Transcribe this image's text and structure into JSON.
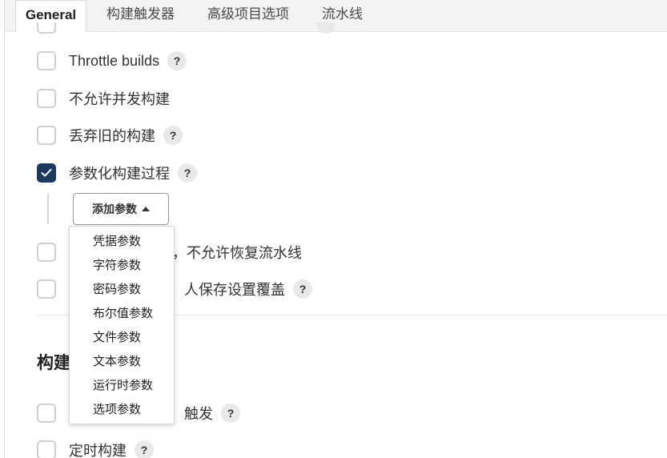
{
  "tabs": [
    {
      "label": "General",
      "active": true
    },
    {
      "label": "构建触发器",
      "active": false
    },
    {
      "label": "高级项目选项",
      "active": false
    },
    {
      "label": "流水线",
      "active": false
    }
  ],
  "general": {
    "throttle_label": "Throttle builds",
    "concurrent_label": "不允许并发构建",
    "discard_label": "丢弃旧的构建",
    "parameterized_label": "参数化构建过程",
    "resume_label": "，不允许恢复流水线",
    "override_label": "人保存设置覆盖",
    "help_glyph": "?"
  },
  "add_parameter": {
    "label": "添加参数",
    "options": [
      "凭据参数",
      "字符参数",
      "密码参数",
      "布尔值参数",
      "文件参数",
      "文本参数",
      "运行时参数",
      "选项参数"
    ]
  },
  "triggers": {
    "title": "构建",
    "remote_label": "触发",
    "periodic_label": "定时构建"
  },
  "colors": {
    "accent": "#1c3a5e",
    "tab_bar_bg": "#f3f3f3",
    "help_bg": "#e9e9e9"
  }
}
